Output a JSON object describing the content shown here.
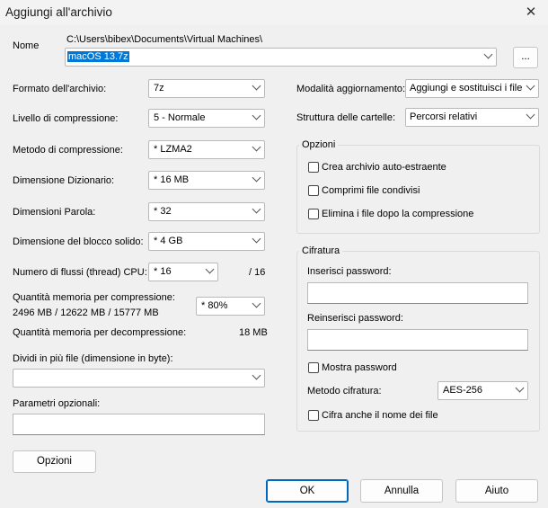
{
  "window": {
    "title": "Aggiungi all'archivio",
    "close": "✕"
  },
  "name": {
    "label": "Nome",
    "path": "C:\\Users\\bibex\\Documents\\Virtual Machines\\",
    "value": "macOS 13.7z",
    "browse": "..."
  },
  "left": {
    "format": {
      "label": "Formato dell'archivio:",
      "value": "7z"
    },
    "level": {
      "label": "Livello di compressione:",
      "value": "5 - Normale"
    },
    "method": {
      "label": "Metodo di compressione:",
      "value": "*  LZMA2"
    },
    "dict": {
      "label": "Dimensione Dizionario:",
      "value": "*  16 MB"
    },
    "word": {
      "label": "Dimensioni Parola:",
      "value": "*  32"
    },
    "block": {
      "label": "Dimensione del blocco solido:",
      "value": "*  4 GB"
    },
    "threads": {
      "label": "Numero di flussi (thread) CPU:",
      "value": "*  16",
      "total": "/ 16"
    },
    "mem_comp": {
      "label": "Quantità memoria per compressione:",
      "detail": "2496 MB / 12622 MB / 15777 MB",
      "value": "*  80%"
    },
    "mem_decomp": {
      "label": "Quantità memoria per decompressione:",
      "value": "18 MB"
    },
    "split": {
      "label": "Dividi in più file (dimensione in byte):",
      "value": ""
    },
    "params": {
      "label": "Parametri opzionali:",
      "value": ""
    },
    "options_button": "Opzioni"
  },
  "right": {
    "update_mode": {
      "label": "Modalità aggiornamento:",
      "value": "Aggiungi e sostituisci i file"
    },
    "folder_struct": {
      "label": "Struttura delle cartelle:",
      "value": "Percorsi relativi"
    },
    "options": {
      "title": "Opzioni",
      "items": [
        {
          "label": "Crea archivio auto-estraente",
          "checked": false
        },
        {
          "label": "Comprimi file condivisi",
          "checked": false
        },
        {
          "label": "Elimina i file dopo la compressione",
          "checked": false
        }
      ]
    },
    "encryption": {
      "title": "Cifratura",
      "password_label": "Inserisci password:",
      "repassword_label": "Reinserisci password:",
      "show_password": "Mostra password",
      "method_label": "Metodo cifratura:",
      "method_value": "AES-256",
      "encrypt_names": "Cifra anche il nome dei file"
    }
  },
  "buttons": {
    "ok": "OK",
    "cancel": "Annulla",
    "help": "Aiuto"
  }
}
